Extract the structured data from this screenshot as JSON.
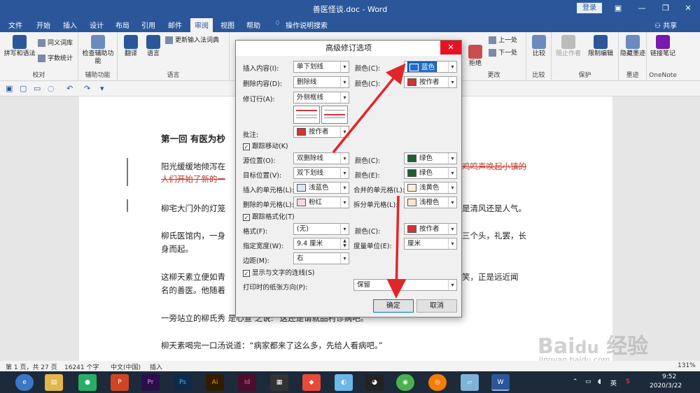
{
  "window": {
    "title": "善医怪谈.doc  -  Word",
    "login": "登录"
  },
  "tabs": [
    "文件",
    "开始",
    "插入",
    "设计",
    "布局",
    "引用",
    "邮件",
    "审阅",
    "视图",
    "帮助",
    "操作说明搜索"
  ],
  "share": "共享",
  "ribbon": {
    "btn_spell": "拼写和语法",
    "btn_thesaurus": "同义词库",
    "btn_wordcount": "字数统计",
    "grp_proofing": "校对",
    "btn_access": "检查辅助功能",
    "grp_access": "辅助功能",
    "btn_translate": "翻译",
    "btn_language": "语言",
    "btn_ime": "更新输入法词典",
    "grp_language": "语言",
    "btn_accept": "接受",
    "btn_reject": "拒绝",
    "btn_prev": "上一处",
    "btn_next": "下一处",
    "grp_changes": "更改",
    "btn_compare": "比较",
    "grp_compare": "比较",
    "btn_block": "阻止作者",
    "btn_restrict": "限制编辑",
    "grp_protect": "保护",
    "btn_ink": "隐藏墨迹",
    "grp_ink": "墨迹",
    "btn_onenote": "链接笔记",
    "grp_onenote": "OneNote"
  },
  "document": {
    "heading": "第一回  有医为杪",
    "p1a": "阳光缓缓地倾泻在",
    "p1b": "鸡鸣声唤起小镇的",
    "p1c": "人们开始了新的一",
    "p2a": "柳宅大门外的灯笼",
    "p2b": "是清风还是人气。",
    "p3a": "柳氏医馆内，一身",
    "p3b": "三个头，礼罢，长",
    "p3c": "身而起。",
    "p4a": "这柳天素立便如青",
    "p4b": "笑，正是远近闻",
    "p4c": "名的善医。他随着",
    "p5": "一旁站立的柳氏秀    是心宣    之说:    \"这还是请就品村诊病吧。\"",
    "p6": "柳天素喝完一口汤说道：“病家都来了这么多，先给人看病吧。”"
  },
  "status": {
    "pages": "第 1 页，共 27 页",
    "words": "16241 个字",
    "lang": "中文(中国)",
    "mode": "插入",
    "zoom": "131%"
  },
  "taskbar": {
    "time": "9:52",
    "date": "2020/3/22"
  },
  "dialog": {
    "title": "高级修订选项",
    "close": "✕",
    "lbl_insert": "插入内容(I):",
    "val_insert": "单下划线",
    "lbl_color1": "颜色(C):",
    "val_color1": "蓝色",
    "lbl_delete": "删除内容(D):",
    "val_delete": "删除线",
    "lbl_color2": "颜色(C):",
    "val_color2": "按作者",
    "lbl_revline": "修订行(A):",
    "val_revline": "外侧框线",
    "lbl_comment": "批注:",
    "val_comment": "按作者",
    "chk_move": "跟踪移动(K)",
    "lbl_from": "源位置(O):",
    "val_from": "双删除线",
    "lbl_color3": "颜色(C):",
    "val_color3": "绿色",
    "lbl_to": "目标位置(V):",
    "val_to": "双下划线",
    "lbl_color4": "颜色(E):",
    "val_color4": "绿色",
    "lbl_insert_cell": "插入的单元格(L):",
    "val_insert_cell": "浅蓝色",
    "lbl_merge_cell": "合并的单元格(L):",
    "val_merge_cell": "浅黄色",
    "lbl_delete_cell": "删除的单元格(L):",
    "val_delete_cell": "粉红",
    "lbl_split_cell": "拆分单元格(L):",
    "val_split_cell": "浅橙色",
    "chk_format": "跟踪格式化(T)",
    "lbl_format": "格式(F):",
    "val_format": "(无)",
    "lbl_color5": "颜色(C):",
    "val_color5": "按作者",
    "lbl_width": "指定宽度(W):",
    "val_width": "9.4 厘米",
    "lbl_unit": "度量单位(E):",
    "val_unit": "厘米",
    "lbl_margin": "边距(M):",
    "val_margin": "右",
    "chk_lines": "显示与文字的连线(S)",
    "lbl_paper": "打印时的纸张方向(P):",
    "val_paper": "保留",
    "btn_ok": "确定",
    "btn_cancel": "取消"
  },
  "colors": {
    "blue": "#1e6fd1",
    "red": "#d13438",
    "green": "#1e5f36",
    "lightblue": "#dce8f7",
    "lightyellow": "#faf0d2",
    "pink": "#f7d9e2",
    "lightorange": "#fbe3d3",
    "arrow": "#e0262b"
  }
}
